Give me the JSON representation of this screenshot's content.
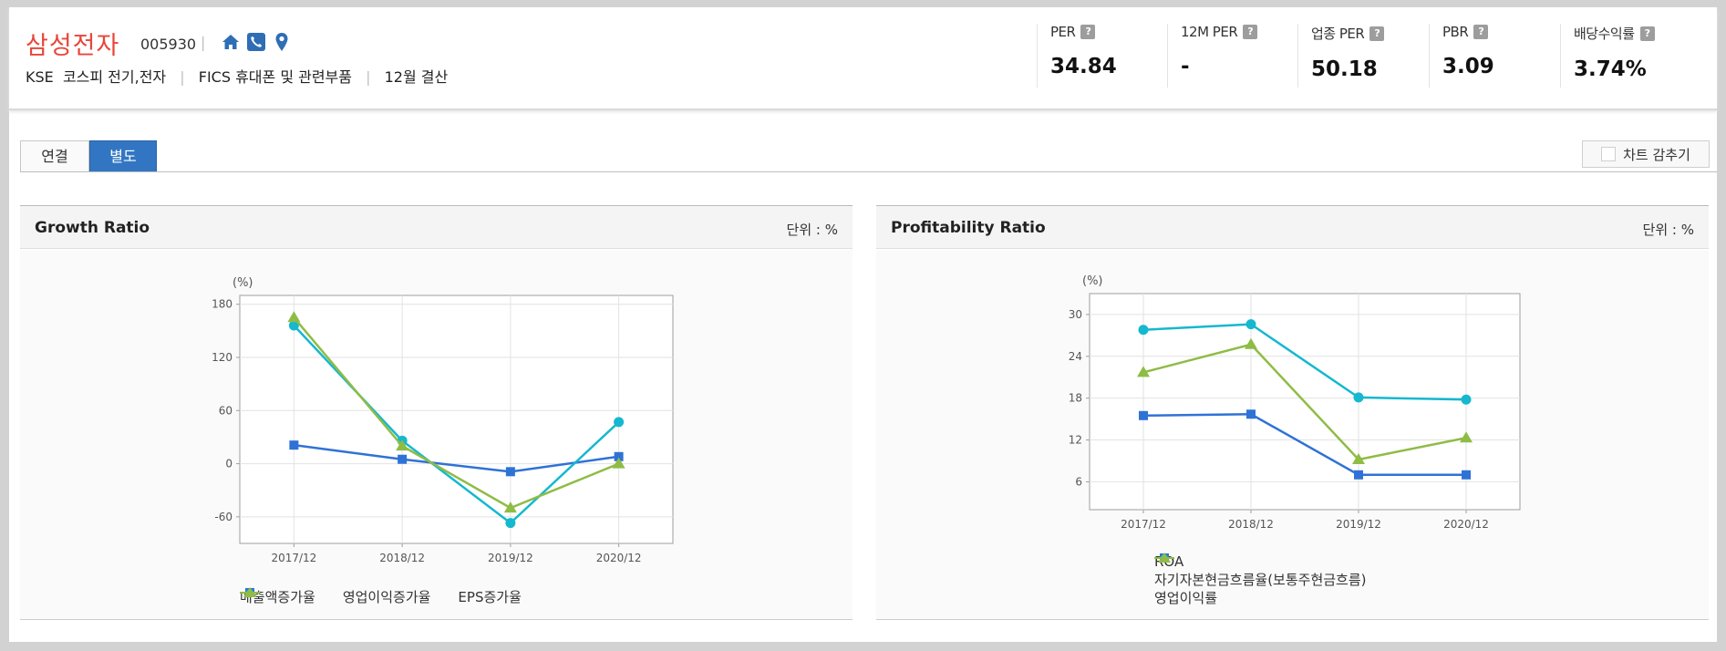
{
  "header": {
    "company_name": "삼성전자",
    "company_code": "005930",
    "separator": "|",
    "market": "KSE",
    "sector": "코스피 전기,전자",
    "fics": "FICS 휴대폰 및 관련부품",
    "settlement": "12월 결산",
    "icons": [
      "home-icon",
      "phone-icon",
      "location-pin-icon"
    ],
    "accent_color": "#e8463a",
    "icon_color": "#2f6db5"
  },
  "metrics": [
    {
      "label": "PER",
      "value": "34.84"
    },
    {
      "label": "12M PER",
      "value": "-"
    },
    {
      "label": "업종 PER",
      "value": "50.18"
    },
    {
      "label": "PBR",
      "value": "3.09"
    },
    {
      "label": "배당수익률",
      "value": "3.74%"
    }
  ],
  "help_icon_text": "?",
  "tabs": [
    {
      "label": "연결",
      "active": false
    },
    {
      "label": "별도",
      "active": true
    }
  ],
  "hide_chart_label": "차트 감추기",
  "panels": [
    {
      "title": "Growth Ratio",
      "unit": "단위 : %"
    },
    {
      "title": "Profitability Ratio",
      "unit": "단위 : %"
    }
  ],
  "chart_data": [
    {
      "type": "line",
      "title": "Growth Ratio",
      "unit_label": "(%)",
      "categories": [
        "2017/12",
        "2018/12",
        "2019/12",
        "2020/12"
      ],
      "ylim": [
        -90,
        190
      ],
      "yticks": [
        -60,
        0,
        60,
        120,
        180
      ],
      "grid": true,
      "legend": "bottom",
      "series": [
        {
          "name": "매출액증가율",
          "color": "#2f72d6",
          "marker": "square",
          "values": [
            21,
            5,
            -9,
            8
          ]
        },
        {
          "name": "영업이익증가율",
          "color": "#15b8cf",
          "marker": "diamond",
          "values": [
            156,
            26,
            -67,
            47
          ]
        },
        {
          "name": "EPS증가율",
          "color": "#8fbc45",
          "marker": "triangle",
          "values": [
            165,
            20,
            -50,
            0
          ]
        }
      ]
    },
    {
      "type": "line",
      "title": "Profitability Ratio",
      "unit_label": "(%)",
      "categories": [
        "2017/12",
        "2018/12",
        "2019/12",
        "2020/12"
      ],
      "ylim": [
        2,
        33
      ],
      "yticks": [
        6,
        12,
        18,
        24,
        30
      ],
      "grid": true,
      "legend": "bottom-stacked",
      "series": [
        {
          "name": "ROA",
          "color": "#2f72d6",
          "marker": "square",
          "values": [
            15.5,
            15.7,
            7.0,
            7.0
          ]
        },
        {
          "name": "자기자본현금흐름율(보통주현금흐름)",
          "color": "#15b8cf",
          "marker": "diamond",
          "values": [
            27.8,
            28.6,
            18.1,
            17.8
          ]
        },
        {
          "name": "영업이익률",
          "color": "#8fbc45",
          "marker": "triangle",
          "values": [
            21.7,
            25.7,
            9.2,
            12.3
          ]
        }
      ]
    }
  ]
}
